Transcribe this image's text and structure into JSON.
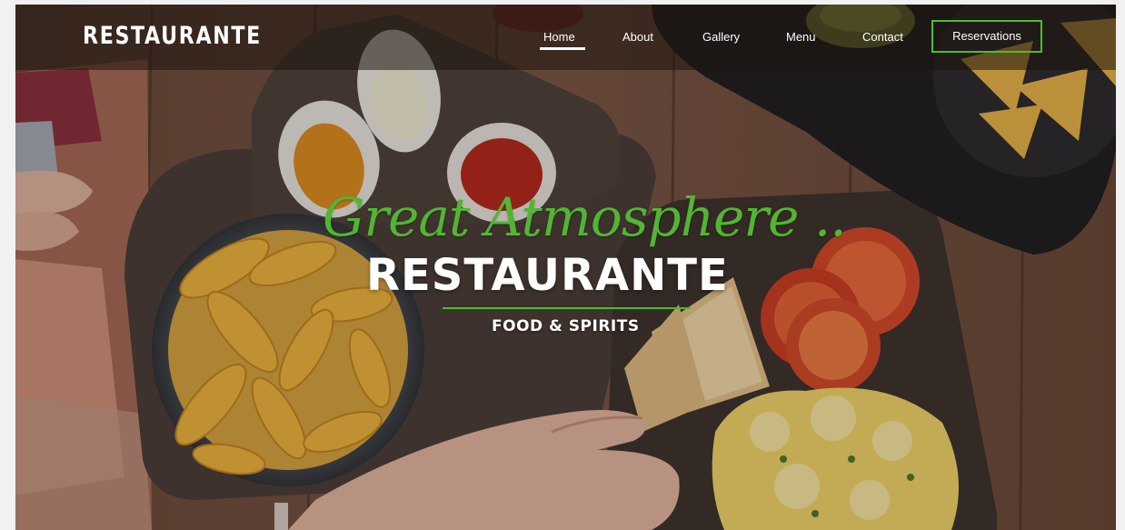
{
  "navbar": {
    "logo": "RESTAURANTE",
    "links": [
      {
        "label": "Home",
        "active": true
      },
      {
        "label": "About"
      },
      {
        "label": "Gallery"
      },
      {
        "label": "Menu"
      },
      {
        "label": "Contact"
      }
    ],
    "reservations_label": "Reservations"
  },
  "hero": {
    "script_heading": "Great Atmosphere ..",
    "title": "RESTAURANTE",
    "subtitle": "FOOD & SPIRITS"
  },
  "colors": {
    "accent_green": "#4bbf2a",
    "script_green": "#52b534",
    "text_white": "#ffffff"
  },
  "icons": {
    "background": "food-table-photo"
  }
}
